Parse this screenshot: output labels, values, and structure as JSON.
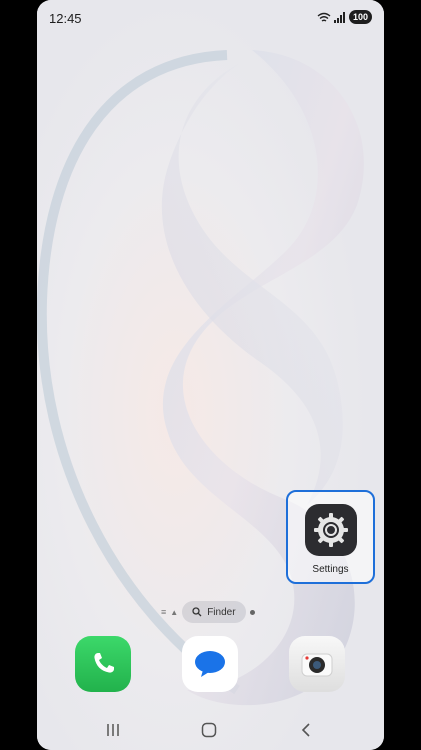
{
  "status_bar": {
    "time": "12:45",
    "battery": "100",
    "icons": [
      "wifi-icon",
      "signal-icon",
      "battery-icon"
    ]
  },
  "home": {
    "apps": [
      {
        "label": "Settings",
        "icon": "gear-icon",
        "highlighted": true
      }
    ],
    "finder": {
      "label": "Finder",
      "icon": "search-icon"
    },
    "dock": [
      {
        "name": "Phone",
        "icon": "phone-icon"
      },
      {
        "name": "Messages",
        "icon": "chat-bubble-icon"
      },
      {
        "name": "Camera",
        "icon": "camera-icon"
      }
    ]
  },
  "navigation": [
    "recents-icon",
    "home-icon",
    "back-icon"
  ],
  "colors": {
    "highlight": "#1e6fd9",
    "phone": "#2bc456",
    "messages": "#1a73e8",
    "camera_accent": "#e53935"
  }
}
